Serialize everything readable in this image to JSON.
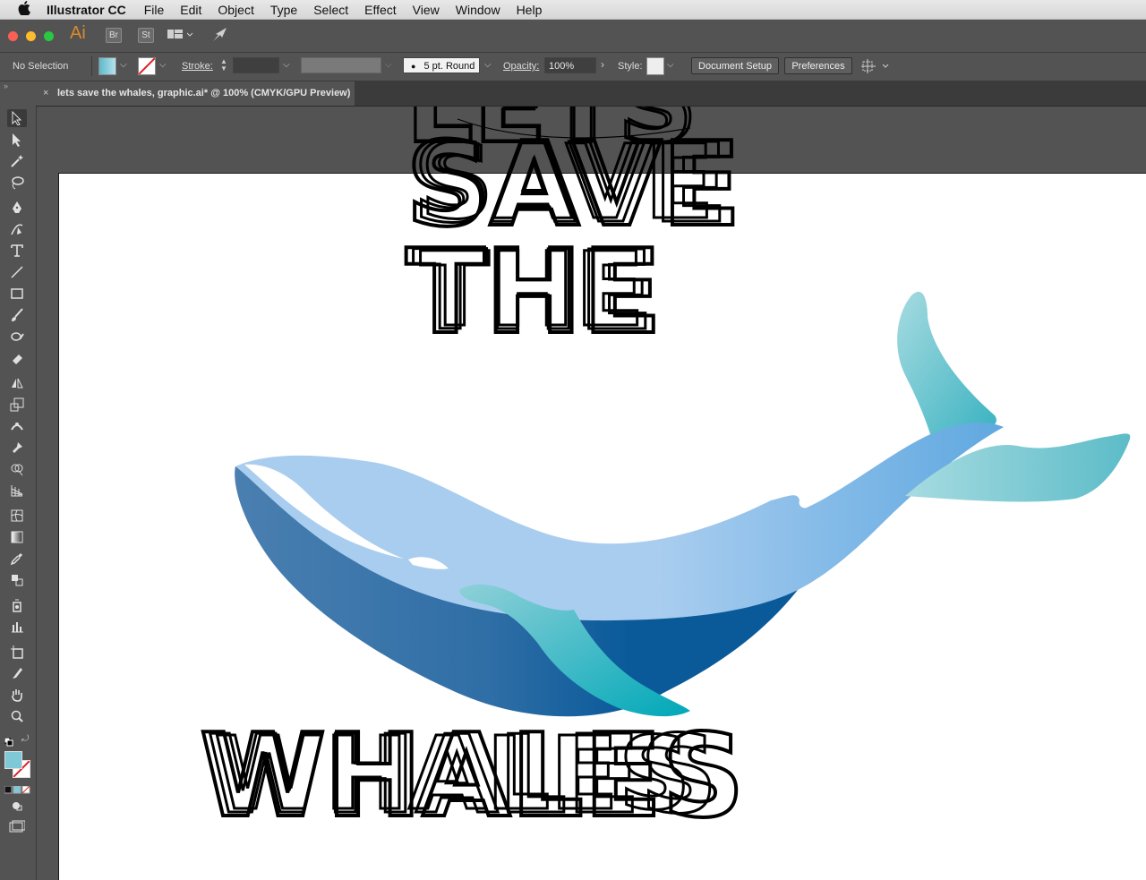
{
  "menubar": {
    "app_name": "Illustrator CC",
    "items": [
      "File",
      "Edit",
      "Object",
      "Type",
      "Select",
      "Effect",
      "View",
      "Window",
      "Help"
    ]
  },
  "appbar": {
    "logo": "Ai",
    "bridge": "Br",
    "stock": "St"
  },
  "controlbar": {
    "selection": "No Selection",
    "stroke_label": "Stroke:",
    "brush": "5 pt. Round",
    "opacity_label": "Opacity:",
    "opacity_value": "100%",
    "style_label": "Style:",
    "document_setup": "Document Setup",
    "preferences": "Preferences",
    "fill_color": "#7ec8d8",
    "stroke_color": "#ffffff"
  },
  "document": {
    "tab_title": "lets save the whales, graphic.ai* @ 100% (CMYK/GPU Preview)",
    "close_glyph": "×"
  },
  "artwork": {
    "line1": "LETS",
    "line2": "SAVE",
    "line3": "THE",
    "line4": "WHALES",
    "whale_colors": {
      "back": "#a9cdef",
      "belly_dark": "#0a5a9a",
      "belly_light": "#4a7fb0",
      "fin": "#1fb3bd",
      "tail": "#8fd0d8"
    }
  },
  "tools": [
    "selection-tool",
    "direct-selection-tool",
    "magic-wand-tool",
    "lasso-tool",
    "pen-tool",
    "curvature-tool",
    "type-tool",
    "line-segment-tool",
    "rectangle-tool",
    "paintbrush-tool",
    "shaper-tool",
    "eraser-tool",
    "rotate-tool",
    "scale-tool",
    "width-tool",
    "puppet-warp-tool",
    "shape-builder-tool",
    "perspective-grid-tool",
    "mesh-tool",
    "gradient-tool",
    "eyedropper-tool",
    "blend-tool",
    "symbol-sprayer-tool",
    "column-graph-tool",
    "artboard-tool",
    "slice-tool",
    "hand-tool",
    "zoom-tool"
  ]
}
